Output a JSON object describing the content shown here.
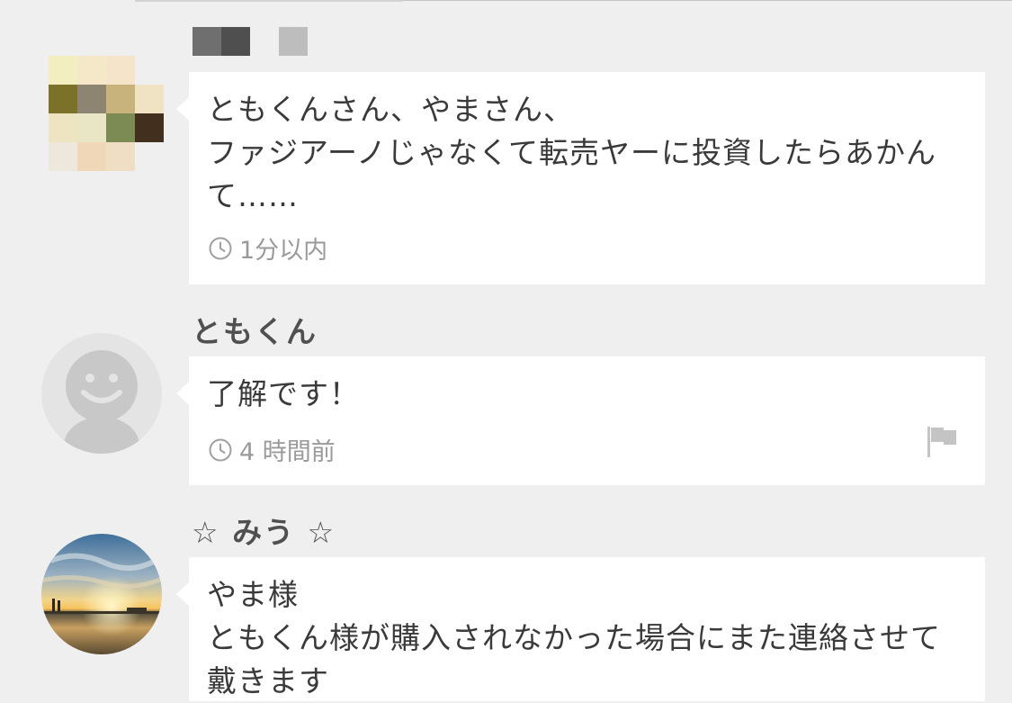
{
  "comments": [
    {
      "author": "",
      "message": "ともくんさん、やまさん、\nファジアーノじゃなくて転売ヤーに投資したらあかんて……",
      "time": "1分以内",
      "avatar": "pixelated-avatar"
    },
    {
      "author": "ともくん",
      "message": "了解です！",
      "time": "4 時間前",
      "avatar": "default-person-avatar",
      "report_icon": "flag-icon"
    },
    {
      "author": "☆ みう ☆",
      "message": "やま様\nともくん様が購入されなかった場合にまた連絡させて戴きます",
      "avatar": "sunset-photo-avatar"
    }
  ],
  "colors": {
    "background": "#efefef",
    "bubble": "#ffffff",
    "meta_text": "#9a9a9a",
    "name_text": "#505050"
  }
}
